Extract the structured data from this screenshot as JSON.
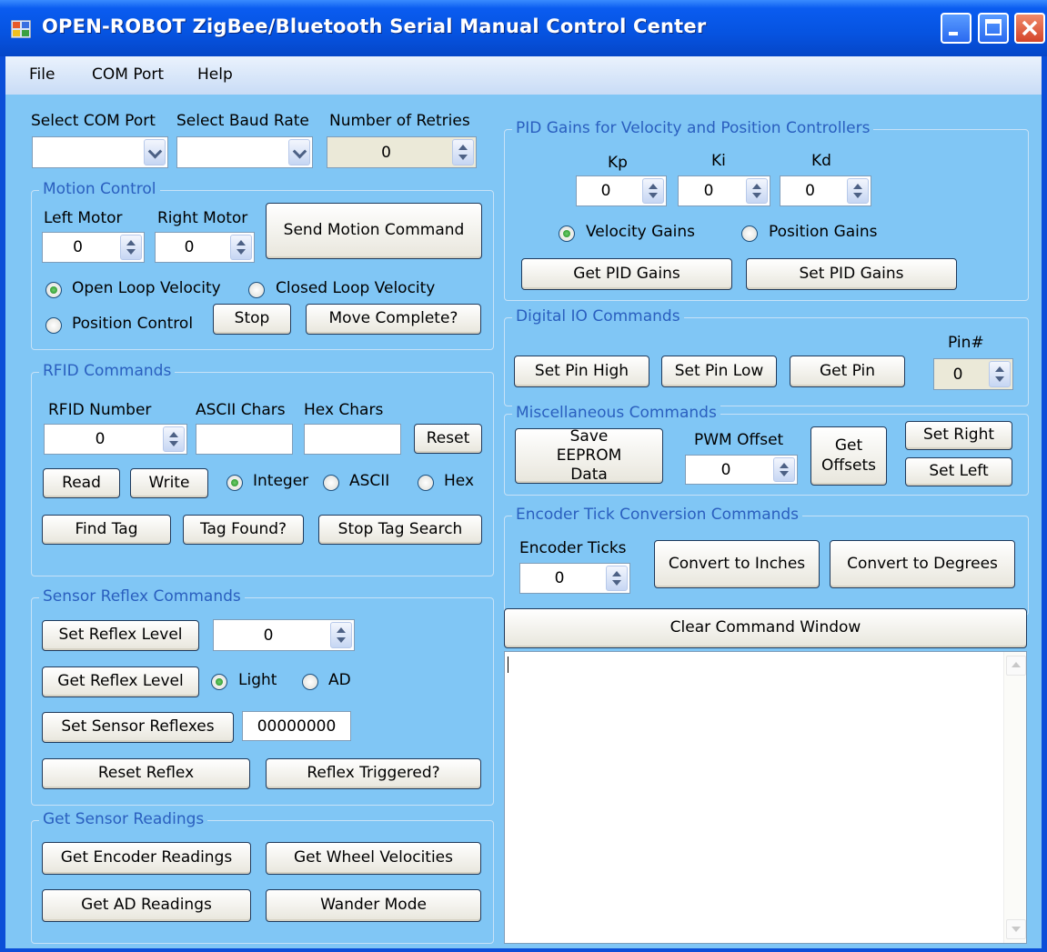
{
  "window": {
    "title": "OPEN-ROBOT ZigBee/Bluetooth Serial Manual Control Center"
  },
  "menu": {
    "file": "File",
    "com_port": "COM Port",
    "help": "Help"
  },
  "connection": {
    "com_port_label": "Select COM Port",
    "baud_rate_label": "Select Baud Rate",
    "retries_label": "Number of Retries",
    "retries_value": "0"
  },
  "motion": {
    "title": "Motion Control",
    "left_label": "Left Motor",
    "right_label": "Right Motor",
    "left_value": "0",
    "right_value": "0",
    "send_button": "Send Motion Command",
    "open_loop": "Open Loop Velocity",
    "closed_loop": "Closed Loop Velocity",
    "position": "Position Control",
    "stop_button": "Stop",
    "move_complete_button": "Move Complete?",
    "selected_mode": "open_loop"
  },
  "rfid": {
    "title": "RFID Commands",
    "number_label": "RFID Number",
    "ascii_label": "ASCII Chars",
    "hex_label": "Hex Chars",
    "number_value": "0",
    "ascii_value": "",
    "hex_value": "",
    "reset_button": "Reset",
    "read_button": "Read",
    "write_button": "Write",
    "integer": "Integer",
    "ascii": "ASCII",
    "hex": "Hex",
    "selected_format": "integer",
    "find_tag_button": "Find Tag",
    "tag_found_button": "Tag Found?",
    "stop_search_button": "Stop Tag Search"
  },
  "reflex": {
    "title": "Sensor Reflex Commands",
    "set_level_button": "Set Reflex Level",
    "level_value": "0",
    "get_level_button": "Get Reflex Level",
    "light": "Light",
    "ad": "AD",
    "selected_sensor": "light",
    "set_reflexes_button": "Set Sensor Reflexes",
    "reflexes_value": "00000000",
    "reset_button": "Reset Reflex",
    "triggered_button": "Reflex Triggered?"
  },
  "readings": {
    "title": "Get Sensor Readings",
    "encoder_button": "Get Encoder Readings",
    "velocities_button": "Get Wheel Velocities",
    "ad_button": "Get AD Readings",
    "wander_button": "Wander Mode"
  },
  "pid": {
    "title": "PID Gains for Velocity and Position Controllers",
    "kp_label": "Kp",
    "ki_label": "Ki",
    "kd_label": "Kd",
    "kp_value": "0",
    "ki_value": "0",
    "kd_value": "0",
    "velocity": "Velocity Gains",
    "position": "Position Gains",
    "selected": "velocity",
    "get_button": "Get PID Gains",
    "set_button": "Set PID Gains"
  },
  "digital_io": {
    "title": "Digital IO Commands",
    "pin_label": "Pin#",
    "pin_value": "0",
    "set_high_button": "Set Pin High",
    "set_low_button": "Set Pin Low",
    "get_pin_button": "Get Pin"
  },
  "misc": {
    "title": "Miscellaneous Commands",
    "save_eeprom_button": "Save EEPROM Data",
    "pwm_label": "PWM Offset",
    "pwm_value": "0",
    "get_offsets_button": "Get Offsets",
    "set_right_button": "Set Right",
    "set_left_button": "Set Left"
  },
  "encoder": {
    "title": "Encoder Tick Conversion Commands",
    "ticks_label": "Encoder Ticks",
    "ticks_value": "0",
    "inches_button": "Convert to Inches",
    "degrees_button": "Convert to Degrees"
  },
  "command_window": {
    "clear_button": "Clear Command Window",
    "text": ""
  },
  "colors": {
    "background": "#80c6f5",
    "group_title": "#2a5fbf",
    "titlebar": "#0653e0"
  }
}
